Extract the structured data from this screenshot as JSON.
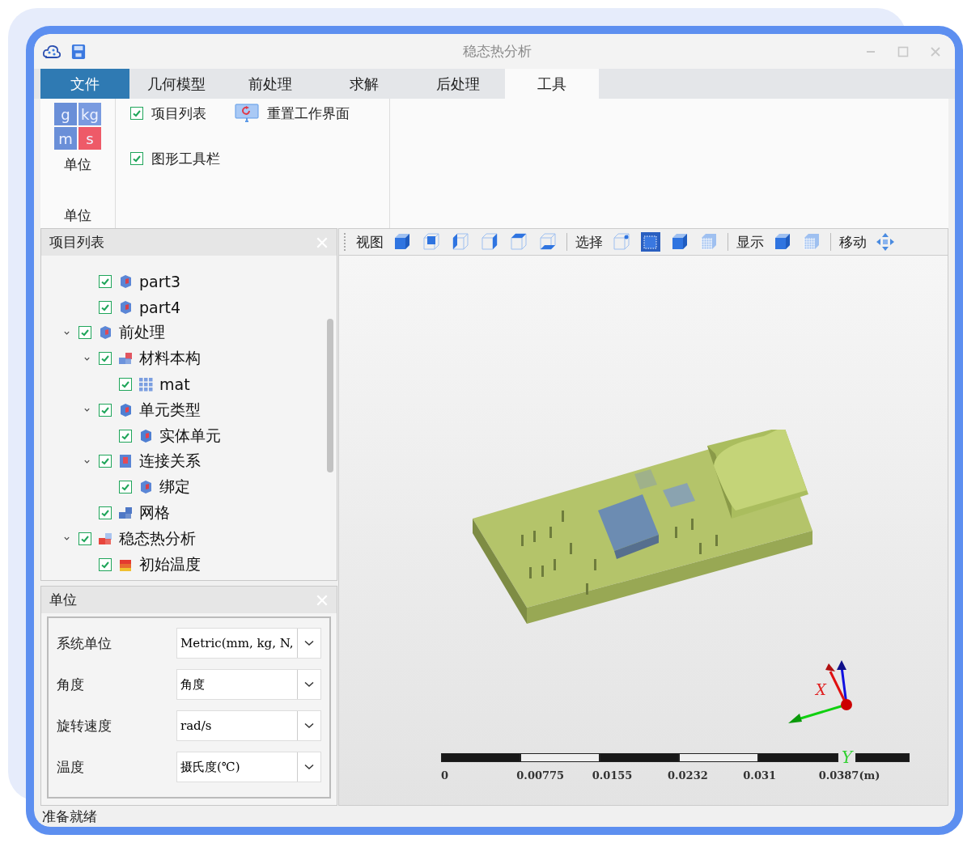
{
  "window": {
    "title": "稳态热分析"
  },
  "tabs": [
    {
      "label": "文件",
      "kind": "file",
      "selected": false
    },
    {
      "label": "几何模型",
      "kind": "tab",
      "selected": false
    },
    {
      "label": "前处理",
      "kind": "tab",
      "selected": false
    },
    {
      "label": "求解",
      "kind": "tab",
      "selected": false
    },
    {
      "label": "后处理",
      "kind": "tab",
      "selected": false
    },
    {
      "label": "工具",
      "kind": "tab",
      "selected": true
    }
  ],
  "ribbon": {
    "unit_icon_letters": [
      "g",
      "kg",
      "m",
      "s"
    ],
    "unit_button": "单位",
    "group_label": "单位",
    "checks": [
      {
        "label": "项目列表",
        "checked": true
      },
      {
        "label": "图形工具栏",
        "checked": true
      }
    ],
    "reset_button": "重置工作界面"
  },
  "project_panel": {
    "title": "项目列表",
    "partial_branch": [
      {
        "label": "part3",
        "kind": "part",
        "checked": true
      },
      {
        "label": "part4",
        "kind": "part",
        "checked": true
      }
    ],
    "items": [
      {
        "label": "前处理",
        "kind": "preprocess",
        "checked": true,
        "expanded": true,
        "children": [
          {
            "label": "材料本构",
            "kind": "material",
            "checked": true,
            "expanded": true,
            "children": [
              {
                "label": "mat",
                "kind": "grid",
                "checked": true
              }
            ]
          },
          {
            "label": "单元类型",
            "kind": "element",
            "checked": true,
            "expanded": true,
            "children": [
              {
                "label": "实体单元",
                "kind": "element",
                "checked": true
              }
            ]
          },
          {
            "label": "连接关系",
            "kind": "connection",
            "checked": true,
            "expanded": true,
            "children": [
              {
                "label": "绑定",
                "kind": "part",
                "checked": true
              }
            ]
          },
          {
            "label": "网格",
            "kind": "mesh",
            "checked": true
          }
        ]
      },
      {
        "label": "稳态热分析",
        "kind": "analysis",
        "checked": true,
        "expanded": true,
        "children": [
          {
            "label": "初始温度",
            "kind": "temperature",
            "checked": true
          }
        ]
      }
    ]
  },
  "unit_panel": {
    "title": "单位",
    "fields": [
      {
        "label": "系统单位",
        "value": "Metric(mm, kg, N,"
      },
      {
        "label": "角度",
        "value": "角度"
      },
      {
        "label": "旋转速度",
        "value": "rad/s"
      },
      {
        "label": "温度",
        "value": "摄氏度(℃)"
      }
    ]
  },
  "toolbar": [
    {
      "kind": "view",
      "label": "视图"
    },
    {
      "kind": "select",
      "label": "选择"
    },
    {
      "kind": "display",
      "label": "显示"
    },
    {
      "kind": "move",
      "label": "移动"
    }
  ],
  "viewport": {
    "axis_x_label": "X",
    "axis_y_label": "Y",
    "scale_labels": [
      "0",
      "0.00775",
      "0.0155",
      "0.0232",
      "0.031",
      "0.0387(m)"
    ]
  },
  "status_bar": "准备就绪"
}
